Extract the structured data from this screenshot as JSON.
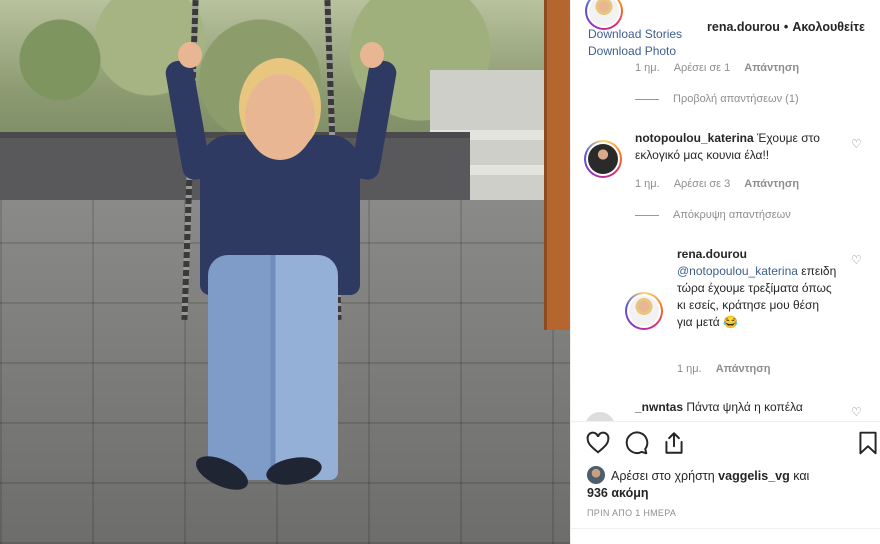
{
  "header": {
    "download_stories": "Download Stories",
    "download_photo": "Download Photo",
    "username": "rena.dourou",
    "separator": "•",
    "follow_status": "Ακολουθείτε"
  },
  "comments": {
    "top_meta": {
      "age": "1 ημ.",
      "likes": "Αρέσει σε 1",
      "reply": "Απάντηση"
    },
    "view_replies": "Προβολή απαντήσεων (1)",
    "c1": {
      "username": "notopoulou_katerina",
      "text": "Έχουμε στο εκλογικό μας κουνια έλα!!",
      "age": "1 ημ.",
      "likes": "Αρέσει σε 3",
      "reply": "Απάντηση"
    },
    "hide_replies": "Απόκρυψη απαντήσεων",
    "c2": {
      "username": "rena.dourou",
      "mention": "@notopoulou_katerina",
      "text": "επειδη τώρα έχουμε τρεξίματα όπως κι εσείς, κράτησε μου θέση για μετά 😂",
      "age": "1 ημ.",
      "reply": "Απάντηση"
    },
    "c3": {
      "username": "_nwntas",
      "text": "Πάντα ψηλά η κοπέλα"
    }
  },
  "actions": {
    "like_icon": "heart-icon",
    "comment_icon": "comment-icon",
    "share_icon": "share-icon",
    "save_icon": "bookmark-icon"
  },
  "likes": {
    "prefix": "Αρέσει στο χρήστη",
    "user": "vaggelis_vg",
    "suffix": "και",
    "count": "936 ακόμη"
  },
  "timestamp": "ΠΡΙΝ ΑΠΟ 1 ΗΜΕΡΑ",
  "colors": {
    "link": "#3d5f8f",
    "muted": "#8e8e8e",
    "text": "#262626"
  }
}
